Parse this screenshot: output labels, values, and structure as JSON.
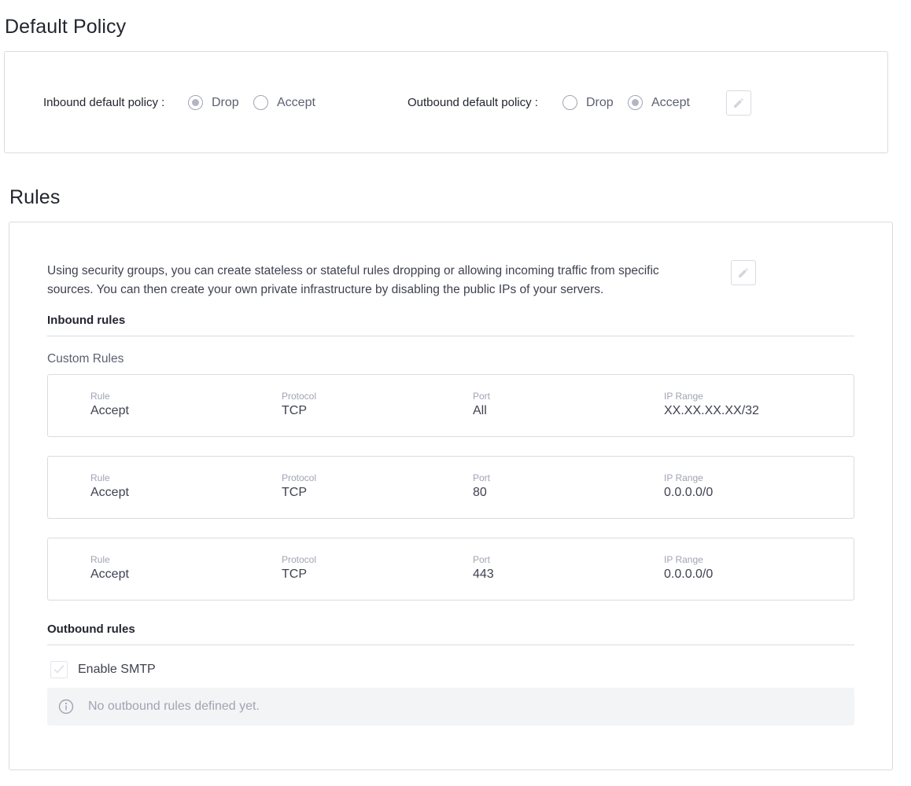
{
  "default_policy": {
    "title": "Default Policy",
    "inbound": {
      "label": "Inbound default policy :",
      "options": [
        "Drop",
        "Accept"
      ],
      "selected": "Drop"
    },
    "outbound": {
      "label": "Outbound default policy :",
      "options": [
        "Drop",
        "Accept"
      ],
      "selected": "Accept"
    },
    "edit_icon": "pencil-icon"
  },
  "rules": {
    "title": "Rules",
    "description": "Using security groups, you can create stateless or stateful rules dropping or allowing incoming traffic from specific sources. You can then create your own private infrastructure by disabling the public IPs of your servers.",
    "edit_icon": "pencil-icon",
    "inbound_heading": "Inbound rules",
    "custom_rules_label": "Custom Rules",
    "columns": [
      "Rule",
      "Protocol",
      "Port",
      "IP Range"
    ],
    "rows": [
      {
        "rule": "Accept",
        "protocol": "TCP",
        "port": "All",
        "ip_range": "XX.XX.XX.XX/32"
      },
      {
        "rule": "Accept",
        "protocol": "TCP",
        "port": "80",
        "ip_range": "0.0.0.0/0"
      },
      {
        "rule": "Accept",
        "protocol": "TCP",
        "port": "443",
        "ip_range": "0.0.0.0/0"
      }
    ],
    "outbound_heading": "Outbound rules",
    "smtp": {
      "label": "Enable SMTP",
      "checked": true,
      "disabled": true
    },
    "notice": {
      "icon": "info-icon",
      "text": "No outbound rules defined yet."
    }
  },
  "colors": {
    "border": "#d9dbe3",
    "text_primary": "#23252f",
    "text_secondary": "#5d6073",
    "muted": "#a0a4b2",
    "notice_bg": "#f3f4f6"
  }
}
